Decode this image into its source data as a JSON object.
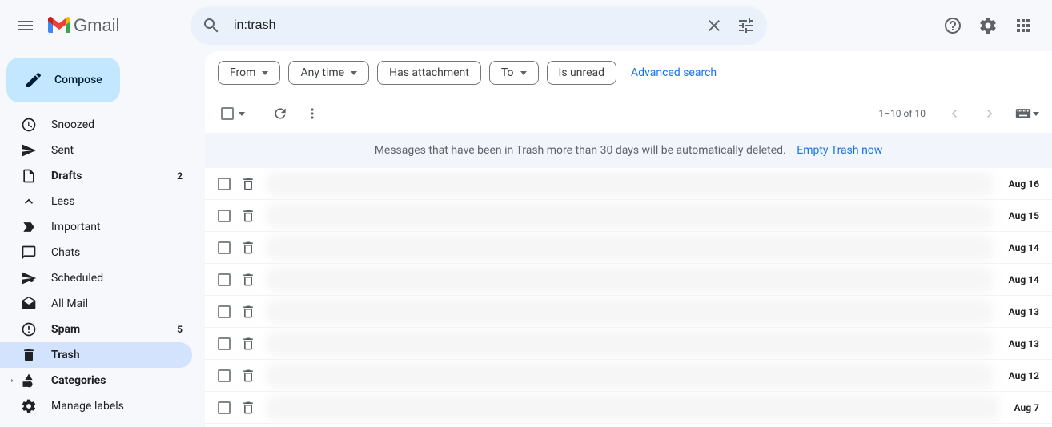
{
  "header": {
    "app_name": "Gmail",
    "search_value": "in:trash"
  },
  "compose_label": "Compose",
  "sidebar": {
    "items": [
      {
        "label": "Snoozed",
        "icon": "clock",
        "count": ""
      },
      {
        "label": "Sent",
        "icon": "send",
        "count": ""
      },
      {
        "label": "Drafts",
        "icon": "file",
        "count": "2",
        "bold": true
      },
      {
        "label": "Less",
        "icon": "chevron-up",
        "count": ""
      },
      {
        "label": "Important",
        "icon": "important",
        "count": ""
      },
      {
        "label": "Chats",
        "icon": "chat",
        "count": ""
      },
      {
        "label": "Scheduled",
        "icon": "scheduled",
        "count": ""
      },
      {
        "label": "All Mail",
        "icon": "allmail",
        "count": ""
      },
      {
        "label": "Spam",
        "icon": "spam",
        "count": "5",
        "bold": true
      },
      {
        "label": "Trash",
        "icon": "trash",
        "count": "",
        "active": true,
        "bold": true
      },
      {
        "label": "Categories",
        "icon": "categories",
        "count": "",
        "bold": true,
        "expandable": true
      },
      {
        "label": "Manage labels",
        "icon": "settings",
        "count": ""
      }
    ]
  },
  "filters": {
    "from": "From",
    "any_time": "Any time",
    "has_attachment": "Has attachment",
    "to": "To",
    "is_unread": "Is unread",
    "advanced": "Advanced search"
  },
  "toolbar": {
    "pagination": "1–10 of 10"
  },
  "trash_notice": {
    "text": "Messages that have been in Trash more than 30 days will be automatically deleted.",
    "link": "Empty Trash now"
  },
  "messages": [
    {
      "date": "Aug 16"
    },
    {
      "date": "Aug 15"
    },
    {
      "date": "Aug 14"
    },
    {
      "date": "Aug 14"
    },
    {
      "date": "Aug 13"
    },
    {
      "date": "Aug 13"
    },
    {
      "date": "Aug 12"
    },
    {
      "date": "Aug 7"
    }
  ]
}
